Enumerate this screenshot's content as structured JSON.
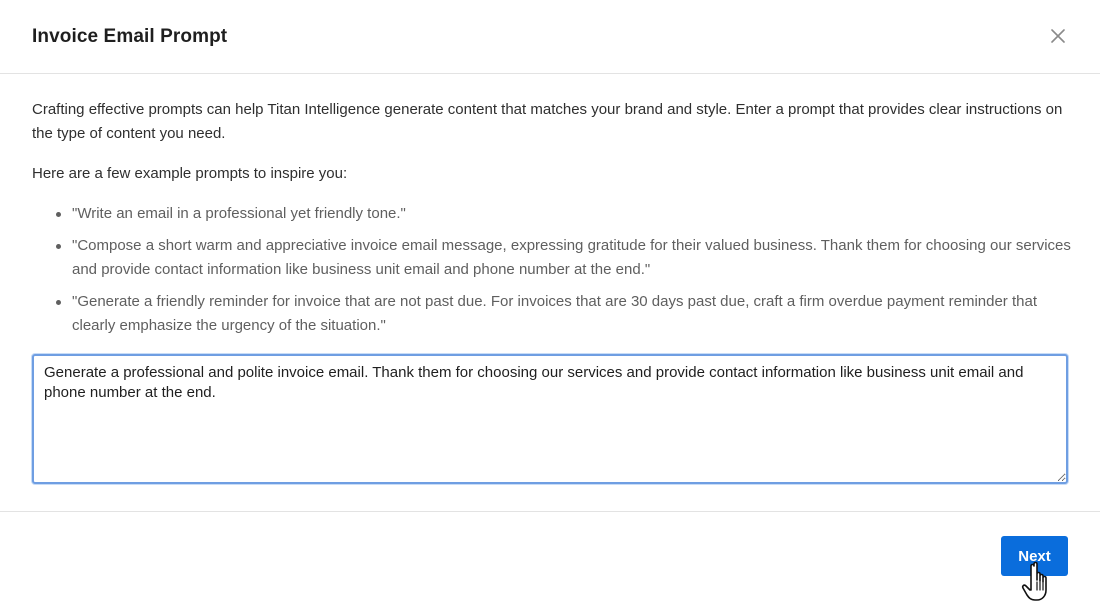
{
  "dialog": {
    "title": "Invoice Email Prompt",
    "close_icon": "close-icon"
  },
  "body": {
    "intro": "Crafting effective prompts can help Titan Intelligence generate content that matches your brand and style. Enter a prompt that provides clear instructions on the type of content you need.",
    "examples_heading": "Here are a few example prompts to inspire you:",
    "examples": [
      "\"Write an email in a professional yet friendly tone.\"",
      "\"Compose a short warm and appreciative invoice email message, expressing gratitude for their valued business. Thank them for choosing our services and provide contact information like business unit email and phone number at the end.\"",
      "\"Generate a friendly reminder for invoice that are not past due. For invoices that are 30 days past due, craft a firm overdue payment reminder that clearly emphasize the urgency of the situation.\""
    ]
  },
  "prompt": {
    "value": "Generate a professional and polite invoice email. Thank them for choosing our services and provide contact information like business unit email and phone number at the end."
  },
  "footer": {
    "next_label": "Next"
  },
  "colors": {
    "primary": "#0a6ddc",
    "focus_border": "#6f9ee2"
  }
}
